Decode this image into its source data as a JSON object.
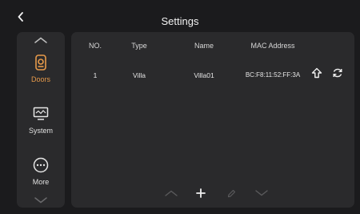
{
  "header": {
    "title": "Settings",
    "back_icon": "chevron-left-icon"
  },
  "sidebar": {
    "items": [
      {
        "label": "Doors",
        "icon": "door-icon",
        "active": true
      },
      {
        "label": "System",
        "icon": "monitor-icon",
        "active": false
      },
      {
        "label": "More",
        "icon": "more-icon",
        "active": false
      }
    ]
  },
  "table": {
    "columns": [
      "NO.",
      "Type",
      "Name",
      "MAC Address"
    ],
    "rows": [
      {
        "no": "1",
        "type": "Villa",
        "name": "Villa01",
        "mac": "BC:F8:11:52:FF:3A"
      }
    ]
  },
  "toolbar": {
    "icons": [
      "chevron-up-icon",
      "add-icon",
      "edit-icon",
      "chevron-down-icon"
    ]
  },
  "colors": {
    "accent": "#e79a4a",
    "background": "#1b1b1d",
    "panel": "#2a2a2c"
  }
}
